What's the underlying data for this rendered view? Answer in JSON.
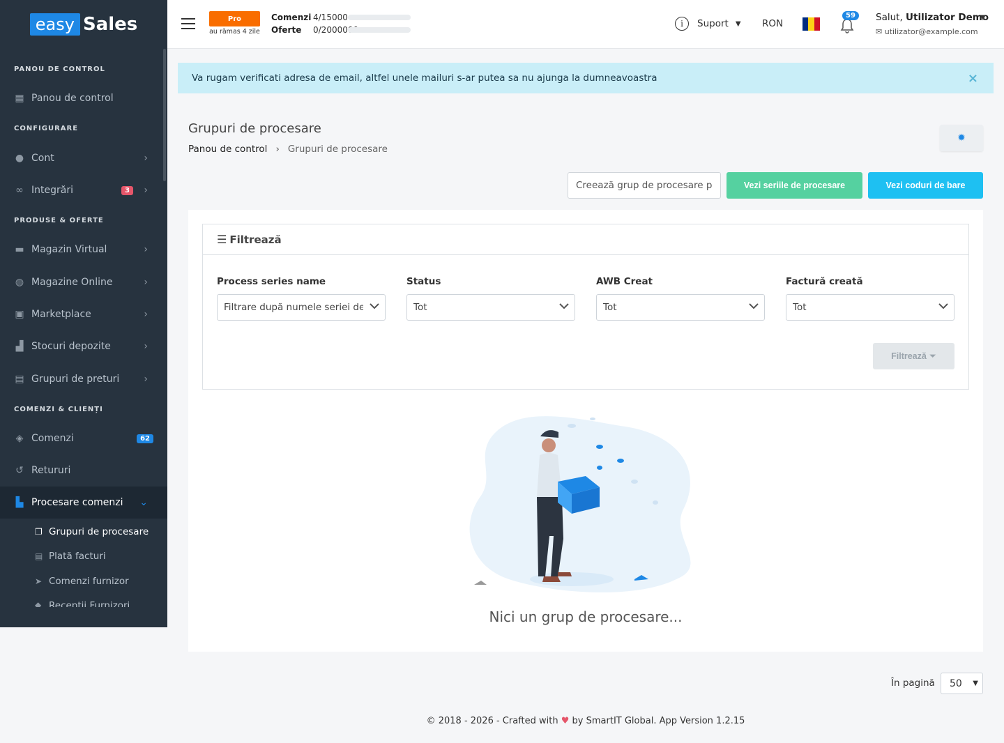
{
  "brand": {
    "part1": "easy",
    "part2": "Sales"
  },
  "sidebar": {
    "sections": [
      "PANOU DE CONTROL",
      "CONFIGURARE",
      "PRODUSE & OFERTE",
      "COMENZI & CLIENȚI"
    ],
    "items": [
      {
        "label": "Panou de control",
        "icon": "dashboard-icon"
      },
      {
        "label": "Cont",
        "icon": "user-icon"
      },
      {
        "label": "Integrări",
        "icon": "link-icon",
        "badge": "3"
      },
      {
        "label": "Magazin Virtual",
        "icon": "store-icon"
      },
      {
        "label": "Magazine Online",
        "icon": "globe-icon"
      },
      {
        "label": "Marketplace",
        "icon": "money-icon"
      },
      {
        "label": "Stocuri depozite",
        "icon": "boxes-icon"
      },
      {
        "label": "Grupuri de preturi",
        "icon": "calculator-icon"
      },
      {
        "label": "Comenzi",
        "icon": "tags-icon",
        "badge": "62"
      },
      {
        "label": "Retururi",
        "icon": "undo-icon"
      },
      {
        "label": "Procesare comenzi",
        "icon": "dolly-icon"
      }
    ],
    "subitems": [
      {
        "label": "Grupuri de procesare",
        "icon": "copy-icon"
      },
      {
        "label": "Plată facturi",
        "icon": "invoice-icon"
      },
      {
        "label": "Comenzi furnizor",
        "icon": "send-icon"
      },
      {
        "label": "Recepții Furnizori",
        "icon": "box-icon"
      }
    ]
  },
  "header": {
    "plan": "Pro",
    "plan_remaining": "au rămas 4 zile",
    "orders_label": "Comenzi",
    "orders_value": "4/15000",
    "offers_label": "Oferte",
    "offers_value": "0/2000000",
    "support": "Suport",
    "currency": "RON",
    "notifications": "59",
    "greeting": "Salut,",
    "user_name": "Utilizator Demo",
    "email": "utilizator@example.com"
  },
  "alert": {
    "text": "Va rugam verificati adresa de email, altfel unele mailuri s-ar putea sa nu ajunga la dumneavoastra",
    "close": "×"
  },
  "page": {
    "title": "Grupuri de procesare",
    "breadcrumb": [
      "Panou de control",
      "Grupuri de procesare"
    ],
    "create_placeholder": "Creează grup de procesare pr",
    "btn_series": "Vezi seriile de procesare",
    "btn_barcodes": "Vezi coduri de bare"
  },
  "filter": {
    "title": "Filtrează",
    "fields": [
      {
        "label": "Process series name",
        "value": "Filtrare după numele seriei de p"
      },
      {
        "label": "Status",
        "value": "Tot"
      },
      {
        "label": "AWB Creat",
        "value": "Tot"
      },
      {
        "label": "Factură creată",
        "value": "Tot"
      }
    ],
    "button": "Filtrează"
  },
  "empty_text": "Nici un grup de procesare...",
  "pagination": {
    "label": "În pagină",
    "value": "50"
  },
  "footer": {
    "before": "© 2018 - 2026 - Crafted with",
    "after": "by SmartIT Global. App Version 1.2.15"
  },
  "colors": {
    "sidebar": "#27333f",
    "accent": "#1e88e5",
    "green": "#55d1a0",
    "cyan": "#1ec0f2",
    "orange": "#f96d00"
  }
}
